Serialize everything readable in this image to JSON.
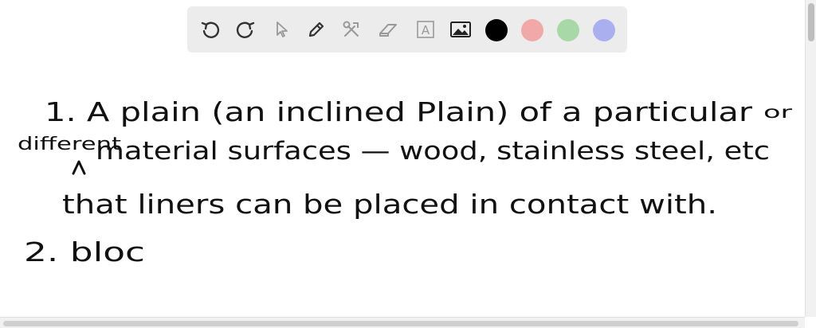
{
  "toolbar": {
    "tools": [
      {
        "name": "undo-icon"
      },
      {
        "name": "redo-icon"
      },
      {
        "name": "pointer-icon"
      },
      {
        "name": "pen-icon"
      },
      {
        "name": "tools-icon"
      },
      {
        "name": "eraser-icon"
      },
      {
        "name": "text-icon",
        "glyph": "A"
      },
      {
        "name": "image-icon"
      }
    ],
    "colors": [
      {
        "name": "black",
        "hex": "#000000"
      },
      {
        "name": "red",
        "hex": "#f1a8a8"
      },
      {
        "name": "green",
        "hex": "#a8d8a8"
      },
      {
        "name": "blue",
        "hex": "#aab0ef"
      }
    ]
  },
  "whiteboard": {
    "lines": [
      {
        "id": "line1",
        "text": "1. A plain (an inclined Plain) of a particular"
      },
      {
        "id": "line1_insert",
        "text": "or"
      },
      {
        "id": "line2_insert",
        "text": "different"
      },
      {
        "id": "line2",
        "text": "material surfaces — wood, stainless steel, etc"
      },
      {
        "id": "line3",
        "text": "that liners can be placed in contact with."
      },
      {
        "id": "line4",
        "text": "2. bloc"
      }
    ]
  }
}
